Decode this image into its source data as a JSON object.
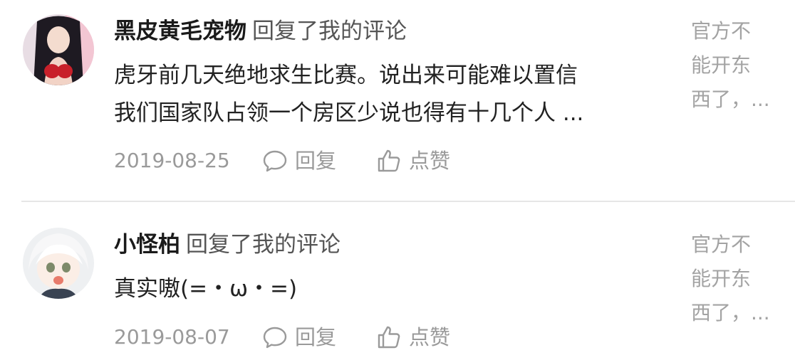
{
  "comments": [
    {
      "username": "黑皮黄毛宠物",
      "action": "回复了我的评论",
      "content_lines": [
        "虎牙前几天绝地求生比赛。说出来可能难以置信",
        "我们国家队占领一个房区少说也得有十几个人 ..."
      ],
      "date": "2019-08-25",
      "reply_label": "回复",
      "like_label": "点赞",
      "source_lines": [
        "官方不",
        "能开东",
        "西了，..."
      ]
    },
    {
      "username": "小怪柏",
      "action": "回复了我的评论",
      "content_lines": [
        "真实嗷(=・ω・=)"
      ],
      "date": "2019-08-07",
      "reply_label": "回复",
      "like_label": "点赞",
      "source_lines": [
        "官方不",
        "能开东",
        "西了，..."
      ]
    }
  ],
  "icons": {
    "reply": "chat-bubble-icon",
    "like": "thumbs-up-icon"
  },
  "colors": {
    "meta_gray": "#9a9a9a",
    "divider": "#e6e6e6"
  }
}
